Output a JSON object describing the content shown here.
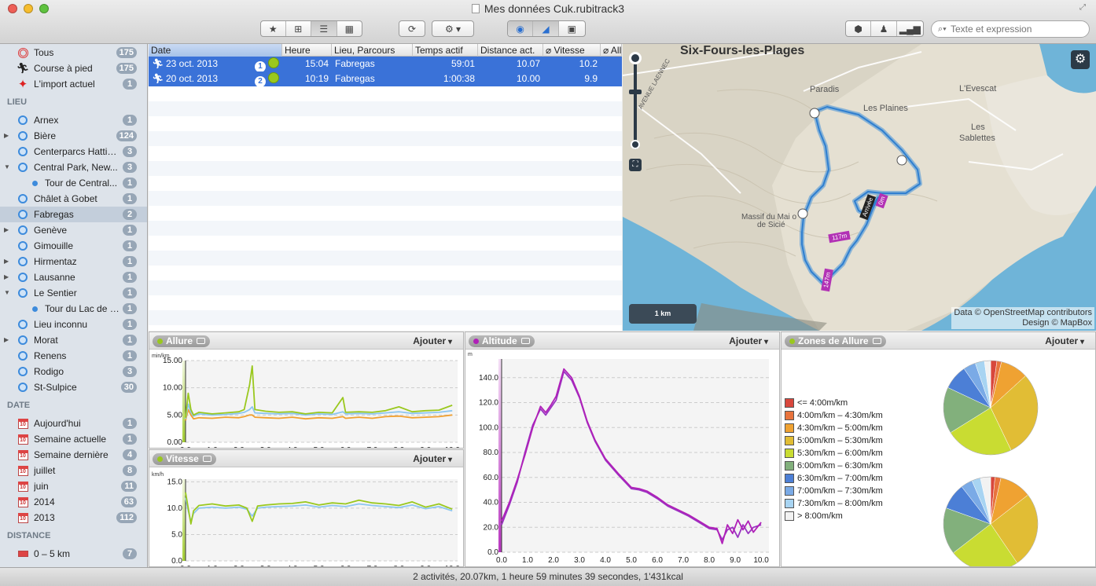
{
  "window": {
    "title": "Mes données Cuk.rubitrack3"
  },
  "toolbar": {
    "search_placeholder": "Texte et expression"
  },
  "sidebar": {
    "top": [
      {
        "label": "Tous",
        "count": "175",
        "icon": "target-icon"
      },
      {
        "label": "Course à pied",
        "count": "175",
        "icon": "runner-icon"
      },
      {
        "label": "L'import actuel",
        "count": "1",
        "icon": "star-icon"
      }
    ],
    "lieu_header": "LIEU",
    "lieu": [
      {
        "label": "Arnex",
        "count": "1",
        "expand": ""
      },
      {
        "label": "Bière",
        "count": "124",
        "expand": "▶"
      },
      {
        "label": "Centerparcs Hattig...",
        "count": "3",
        "expand": ""
      },
      {
        "label": "Central Park, New...",
        "count": "3",
        "expand": "▼"
      },
      {
        "label": "Tour de Central...",
        "count": "1",
        "expand": "",
        "sub": true
      },
      {
        "label": "Châlet à Gobet",
        "count": "1",
        "expand": ""
      },
      {
        "label": "Fabregas",
        "count": "2",
        "expand": "",
        "selected": true
      },
      {
        "label": "Genève",
        "count": "1",
        "expand": "▶"
      },
      {
        "label": "Gimouille",
        "count": "1",
        "expand": ""
      },
      {
        "label": "Hirmentaz",
        "count": "1",
        "expand": "▶"
      },
      {
        "label": "Lausanne",
        "count": "1",
        "expand": "▶"
      },
      {
        "label": "Le Sentier",
        "count": "1",
        "expand": "▼"
      },
      {
        "label": "Tour du Lac de J...",
        "count": "1",
        "expand": "",
        "sub": true
      },
      {
        "label": "Lieu inconnu",
        "count": "1",
        "expand": ""
      },
      {
        "label": "Morat",
        "count": "1",
        "expand": "▶"
      },
      {
        "label": "Renens",
        "count": "1",
        "expand": ""
      },
      {
        "label": "Rodigo",
        "count": "3",
        "expand": ""
      },
      {
        "label": "St-Sulpice",
        "count": "30",
        "expand": ""
      }
    ],
    "date_header": "DATE",
    "date": [
      {
        "label": "Aujourd'hui",
        "count": "1"
      },
      {
        "label": "Semaine actuelle",
        "count": "1"
      },
      {
        "label": "Semaine dernière",
        "count": "4"
      },
      {
        "label": "juillet",
        "count": "8"
      },
      {
        "label": "juin",
        "count": "11"
      },
      {
        "label": "2014",
        "count": "63"
      },
      {
        "label": "2013",
        "count": "112"
      }
    ],
    "distance_header": "DISTANCE",
    "distance": [
      {
        "label": "0 – 5 km",
        "count": "7"
      }
    ],
    "calendar_glyph": "10"
  },
  "table": {
    "columns": [
      "Date",
      "Heure",
      "Lieu, Parcours",
      "Temps actif",
      "Distance act.",
      "⌀ Vitesse",
      "⌀ All"
    ],
    "rows": [
      {
        "date": "23 oct. 2013",
        "num": "1",
        "heure": "15:04",
        "lieu": "Fabregas",
        "temps": "59:01",
        "distance": "10.07",
        "vitesse": "10.2"
      },
      {
        "date": "20 oct. 2013",
        "num": "2",
        "heure": "10:19",
        "lieu": "Fabregas",
        "temps": "1:00:38",
        "distance": "10.00",
        "vitesse": "9.9"
      }
    ]
  },
  "map": {
    "title": "Six-Fours-les-Plages",
    "labels": [
      "Paradis",
      "Les Plaines",
      "L'Evescat",
      "Les",
      "Sablettes",
      "Massif du Mai o",
      "de Sicié",
      "AVENUE LAENNEC"
    ],
    "markers": [
      "117m",
      "147m",
      "Arrivée",
      "0m"
    ],
    "scale": "1 km",
    "attribution_1": "Data © OpenStreetMap contributors",
    "attribution_2": "Design © MapBox"
  },
  "panels": {
    "allure": {
      "title": "Allure",
      "add": "Ajouter",
      "unit": "min/km"
    },
    "vitesse": {
      "title": "Vitesse",
      "add": "Ajouter",
      "unit": "km/h"
    },
    "altitude": {
      "title": "Altitude",
      "add": "Ajouter",
      "unit": "m"
    },
    "zones": {
      "title": "Zones de Allure",
      "add": "Ajouter"
    }
  },
  "chart_data": [
    {
      "type": "line",
      "name_key": "allure",
      "x": [
        0,
        0.1,
        0.2,
        0.3,
        0.5,
        1,
        1.5,
        2,
        2.2,
        2.4,
        2.5,
        2.6,
        3,
        3.5,
        4,
        4.5,
        5,
        5.5,
        5.9,
        6,
        6.5,
        7,
        7.5,
        8,
        8.5,
        9,
        9.5,
        10
      ],
      "series": [
        {
          "values": [
            4.5,
            9,
            6,
            5,
            5.5,
            5.2,
            5.4,
            5.6,
            6,
            10.5,
            14,
            6,
            5.7,
            5.5,
            5.6,
            5.2,
            5.5,
            5.4,
            8.2,
            5.5,
            5.6,
            5.5,
            5.8,
            6.5,
            5.6,
            5.8,
            5.9,
            6.8
          ],
          "color": "#9ac81e"
        },
        {
          "values": [
            4.3,
            7,
            5.5,
            4.8,
            5.2,
            5.0,
            5.1,
            5.3,
            5.5,
            6,
            6.5,
            5.4,
            5.3,
            5.2,
            5.3,
            5.0,
            5.2,
            5.1,
            5.6,
            5.2,
            5.3,
            5.2,
            5.4,
            5.6,
            5.3,
            5.4,
            5.5,
            5.8
          ],
          "color": "#8cc6f0"
        },
        {
          "values": [
            4.0,
            6,
            5,
            4.3,
            4.5,
            4.4,
            4.6,
            4.5,
            4.7,
            5,
            5,
            4.6,
            4.5,
            4.4,
            4.6,
            4.3,
            4.5,
            4.4,
            4.7,
            4.4,
            4.6,
            4.4,
            4.7,
            4.8,
            4.5,
            4.6,
            4.7,
            5.0
          ],
          "color": "#f0a030"
        }
      ],
      "yticks": [
        "0.00",
        "5.00",
        "10.00",
        "15.00"
      ],
      "ylim": [
        0,
        15
      ],
      "xticks": [
        "0.0",
        "1.0",
        "2.0",
        "3.0",
        "4.0",
        "5.0",
        "6.0",
        "7.0",
        "8.0",
        "9.0",
        "10.0"
      ],
      "xlim": [
        0,
        10.2
      ]
    },
    {
      "type": "line",
      "name_key": "vitesse",
      "x": [
        0,
        0.1,
        0.2,
        0.3,
        0.5,
        1,
        1.5,
        2,
        2.3,
        2.5,
        2.7,
        3,
        3.5,
        4,
        4.5,
        5,
        5.5,
        6,
        6.5,
        7,
        7.5,
        8,
        8.5,
        9,
        9.5,
        10
      ],
      "series": [
        {
          "values": [
            13,
            10,
            7,
            9.5,
            10.5,
            10.8,
            10.4,
            10.6,
            10,
            7.5,
            10.4,
            10.6,
            10.8,
            10.9,
            11.2,
            10.6,
            11,
            10.8,
            11.5,
            11,
            10.8,
            10.5,
            11.2,
            10.2,
            10.8,
            9.8
          ],
          "color": "#9ac81e"
        },
        {
          "values": [
            12,
            9.5,
            7.5,
            9,
            10,
            10.2,
            10,
            10.2,
            9.8,
            8.5,
            10,
            10.2,
            10.3,
            10.4,
            10.6,
            10.2,
            10.5,
            10.3,
            10.8,
            10.5,
            10.3,
            10.1,
            10.6,
            9.9,
            10.3,
            9.5
          ],
          "color": "#8cc6f0"
        }
      ],
      "yticks": [
        "0.0",
        "5.0",
        "10.0",
        "15.0"
      ],
      "ylim": [
        0,
        15.5
      ],
      "xticks": [
        "0.0",
        "1.0",
        "2.0",
        "3.0",
        "4.0",
        "5.0",
        "6.0",
        "7.0",
        "8.0",
        "9.0",
        "10.0"
      ],
      "xlim": [
        0,
        10.2
      ]
    },
    {
      "type": "line",
      "name_key": "altitude",
      "x": [
        0,
        0.3,
        0.6,
        0.9,
        1.2,
        1.5,
        1.7,
        1.9,
        2.1,
        2.4,
        2.7,
        3,
        3.3,
        3.6,
        4,
        4.5,
        5,
        5.3,
        5.6,
        6,
        6.4,
        6.8,
        7.2,
        7.6,
        8,
        8.3,
        8.5,
        8.7,
        8.9,
        9.1,
        9.3,
        9.5,
        9.7,
        10
      ],
      "series": [
        {
          "values": [
            25,
            40,
            58,
            78,
            100,
            117,
            112,
            118,
            125,
            147,
            140,
            125,
            105,
            90,
            75,
            63,
            52,
            51,
            49,
            44,
            38,
            34,
            30,
            25,
            20,
            19,
            7,
            22,
            15,
            26,
            18,
            25,
            16,
            24
          ],
          "color": "#b020b8"
        },
        {
          "values": [
            22,
            38,
            56,
            80,
            102,
            115,
            110,
            116,
            122,
            145,
            138,
            124,
            104,
            89,
            74,
            62,
            51,
            50,
            48,
            43,
            37,
            33,
            29,
            24,
            19,
            18,
            10,
            18,
            20,
            12,
            22,
            15,
            20,
            22
          ],
          "color": "#9a34c2"
        }
      ],
      "yticks": [
        "0.0",
        "20.0",
        "40.0",
        "60.0",
        "80.0",
        "100.0",
        "120.0",
        "140.0"
      ],
      "ylim": [
        0,
        155
      ],
      "xticks": [
        "0.0",
        "1.0",
        "2.0",
        "3.0",
        "4.0",
        "5.0",
        "6.0",
        "7.0",
        "8.0",
        "9.0",
        "10.0"
      ],
      "xlim": [
        0,
        10.3
      ]
    },
    {
      "type": "pie",
      "name_key": "zones",
      "legend": [
        {
          "label": "<= 4:00m/km",
          "color": "#d8473c"
        },
        {
          "label": "4:00m/km – 4:30m/km",
          "color": "#e8733c"
        },
        {
          "label": "4:30m/km – 5:00m/km",
          "color": "#efa232"
        },
        {
          "label": "5:00m/km – 5:30m/km",
          "color": "#e1bd35"
        },
        {
          "label": "5:30m/km – 6:00m/km",
          "color": "#c9dc32"
        },
        {
          "label": "6:00m/km – 6:30m/km",
          "color": "#82b07c"
        },
        {
          "label": "6:30m/km – 7:00m/km",
          "color": "#4c7fd6"
        },
        {
          "label": "7:00m/km – 7:30m/km",
          "color": "#7aaae6"
        },
        {
          "label": "7:30m/km – 8:00m/km",
          "color": "#a8d4f2"
        },
        {
          "label": "> 8:00m/km",
          "color": "#f2f2f2"
        }
      ],
      "pies": [
        [
          2,
          1.5,
          9,
          28,
          22,
          15,
          8,
          4,
          3,
          2
        ],
        [
          1.5,
          2,
          11,
          26,
          24,
          16,
          9,
          4,
          3,
          3.5
        ]
      ]
    }
  ],
  "status": {
    "text": "2 activités, 20.07km, 1 heure 59 minutes 39 secondes, 1'431kcal"
  }
}
